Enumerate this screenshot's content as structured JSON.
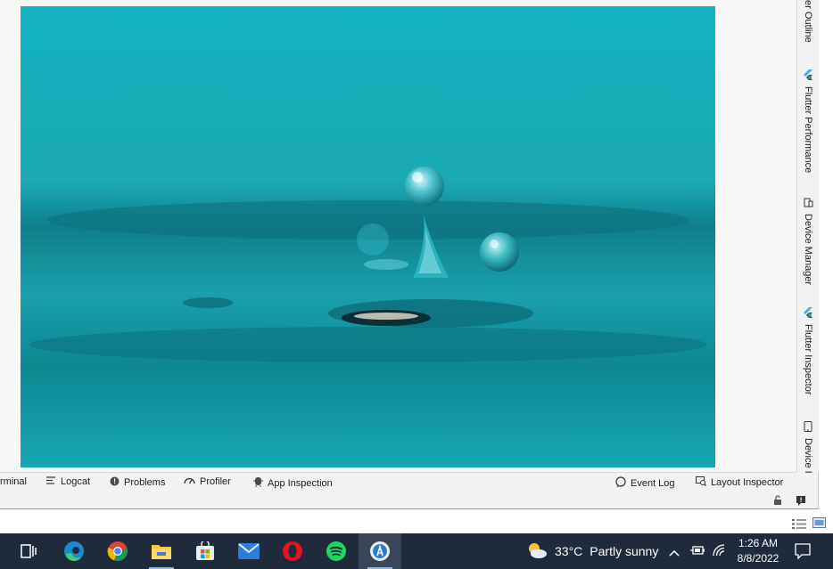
{
  "right_panel": {
    "tabs": [
      {
        "label": "er Outline",
        "icon": "outline-icon"
      },
      {
        "label": "Flutter Performance",
        "icon": "flutter-icon"
      },
      {
        "label": "Device Manager",
        "icon": "device-manager-icon"
      },
      {
        "label": "Flutter Inspector",
        "icon": "flutter-icon"
      },
      {
        "label": "Device I",
        "icon": "device-icon"
      }
    ]
  },
  "tool_windows": {
    "terminal": "rminal",
    "logcat": "Logcat",
    "problems": "Problems",
    "profiler": "Profiler",
    "app_inspection": "App Inspection",
    "event_log": "Event Log",
    "layout_inspector": "Layout Inspector"
  },
  "taskbar": {
    "apps": [
      "task-view-icon",
      "edge-icon",
      "chrome-icon",
      "file-explorer-icon",
      "store-icon",
      "mail-icon",
      "opera-icon",
      "spotify-icon",
      "android-studio-icon"
    ],
    "weather": {
      "temp": "33°C",
      "text": "Partly sunny"
    },
    "clock": {
      "time": "1:26 AM",
      "date": "8/8/2022"
    }
  },
  "colors": {
    "taskbar": "#1f2a3a",
    "water": "#1aa8b4"
  }
}
